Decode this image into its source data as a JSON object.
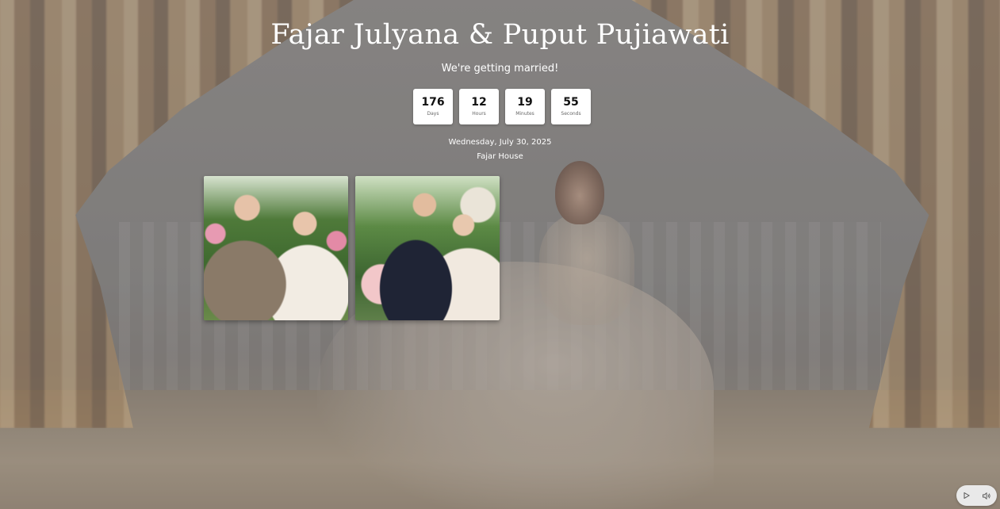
{
  "hero": {
    "couple_names": "Fajar Julyana & Puput Pujiawati",
    "tagline": "We're getting married!"
  },
  "countdown": [
    {
      "value": "176",
      "label": "Days"
    },
    {
      "value": "12",
      "label": "Hours"
    },
    {
      "value": "19",
      "label": "Minutes"
    },
    {
      "value": "55",
      "label": "Seconds"
    }
  ],
  "event": {
    "date": "Wednesday, July 30, 2025",
    "venue": "Fajar House"
  },
  "gallery": {
    "photos": [
      "couple-photo-1",
      "couple-photo-2"
    ]
  },
  "music_controls": {
    "play_icon": "play-icon",
    "volume_icon": "volume-icon"
  },
  "colors": {
    "text": "#ffffff",
    "card_bg": "#ffffff",
    "number_text": "#111111",
    "control_bg": "#e9e9e9"
  }
}
